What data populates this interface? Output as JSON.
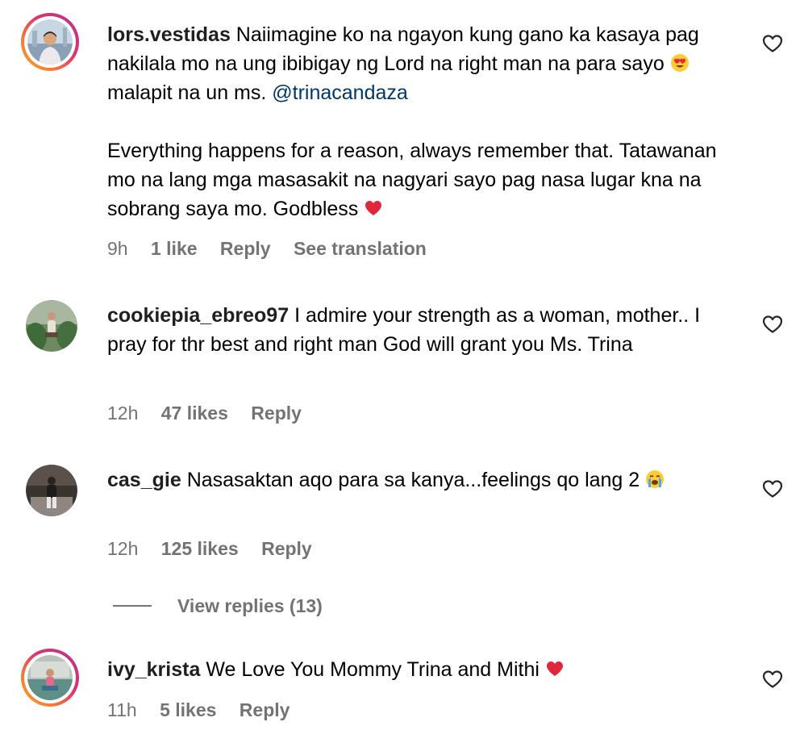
{
  "comments": [
    {
      "username": "lors.vestidas",
      "text_1": " Naiimagine ko na ngayon kung gano ka kasaya pag nakilala mo na ung ibibigay ng Lord na right man na para sayo ",
      "emoji_1": "heart-eyes-emoji",
      "text_2": " malapit na un ms. ",
      "mention": "@trinacandaza",
      "text_3": "\n\nEverything happens for a reason, always remember that. Tatawanan mo na lang mga masasakit na nagyari sayo pag nasa lugar kna na sobrang saya mo. Godbless ",
      "emoji_2": "red-heart-emoji",
      "time": "9h",
      "likes": "1 like",
      "reply": "Reply",
      "translation": "See translation",
      "avatar_style": "story-ring"
    },
    {
      "username": "cookiepia_ebreo97",
      "text_1": " I admire your strength as a woman, mother.. I pray for thr best and right man God will grant you Ms. Trina",
      "time": "12h",
      "likes": "47 likes",
      "reply": "Reply",
      "avatar_style": "plain"
    },
    {
      "username": "cas_gie",
      "text_1": " Nasasaktan aqo para sa kanya...feelings qo lang 2 ",
      "emoji_1": "crying-face-emoji",
      "time": "12h",
      "likes": "125 likes",
      "reply": "Reply",
      "avatar_style": "plain"
    },
    {
      "username": "ivy_krista",
      "text_1": " We Love You Mommy Trina and Mithi ",
      "emoji_1": "red-heart-emoji",
      "time": "11h",
      "likes": "5 likes",
      "reply": "Reply",
      "avatar_style": "story-ring"
    }
  ],
  "view_replies": "View replies (13)",
  "colors": {
    "text": "#000000",
    "username": "#1f1f1f",
    "meta": "#737373",
    "mention": "#00376b",
    "background": "#ffffff"
  },
  "icons": {
    "like": "heart-outline-icon"
  }
}
